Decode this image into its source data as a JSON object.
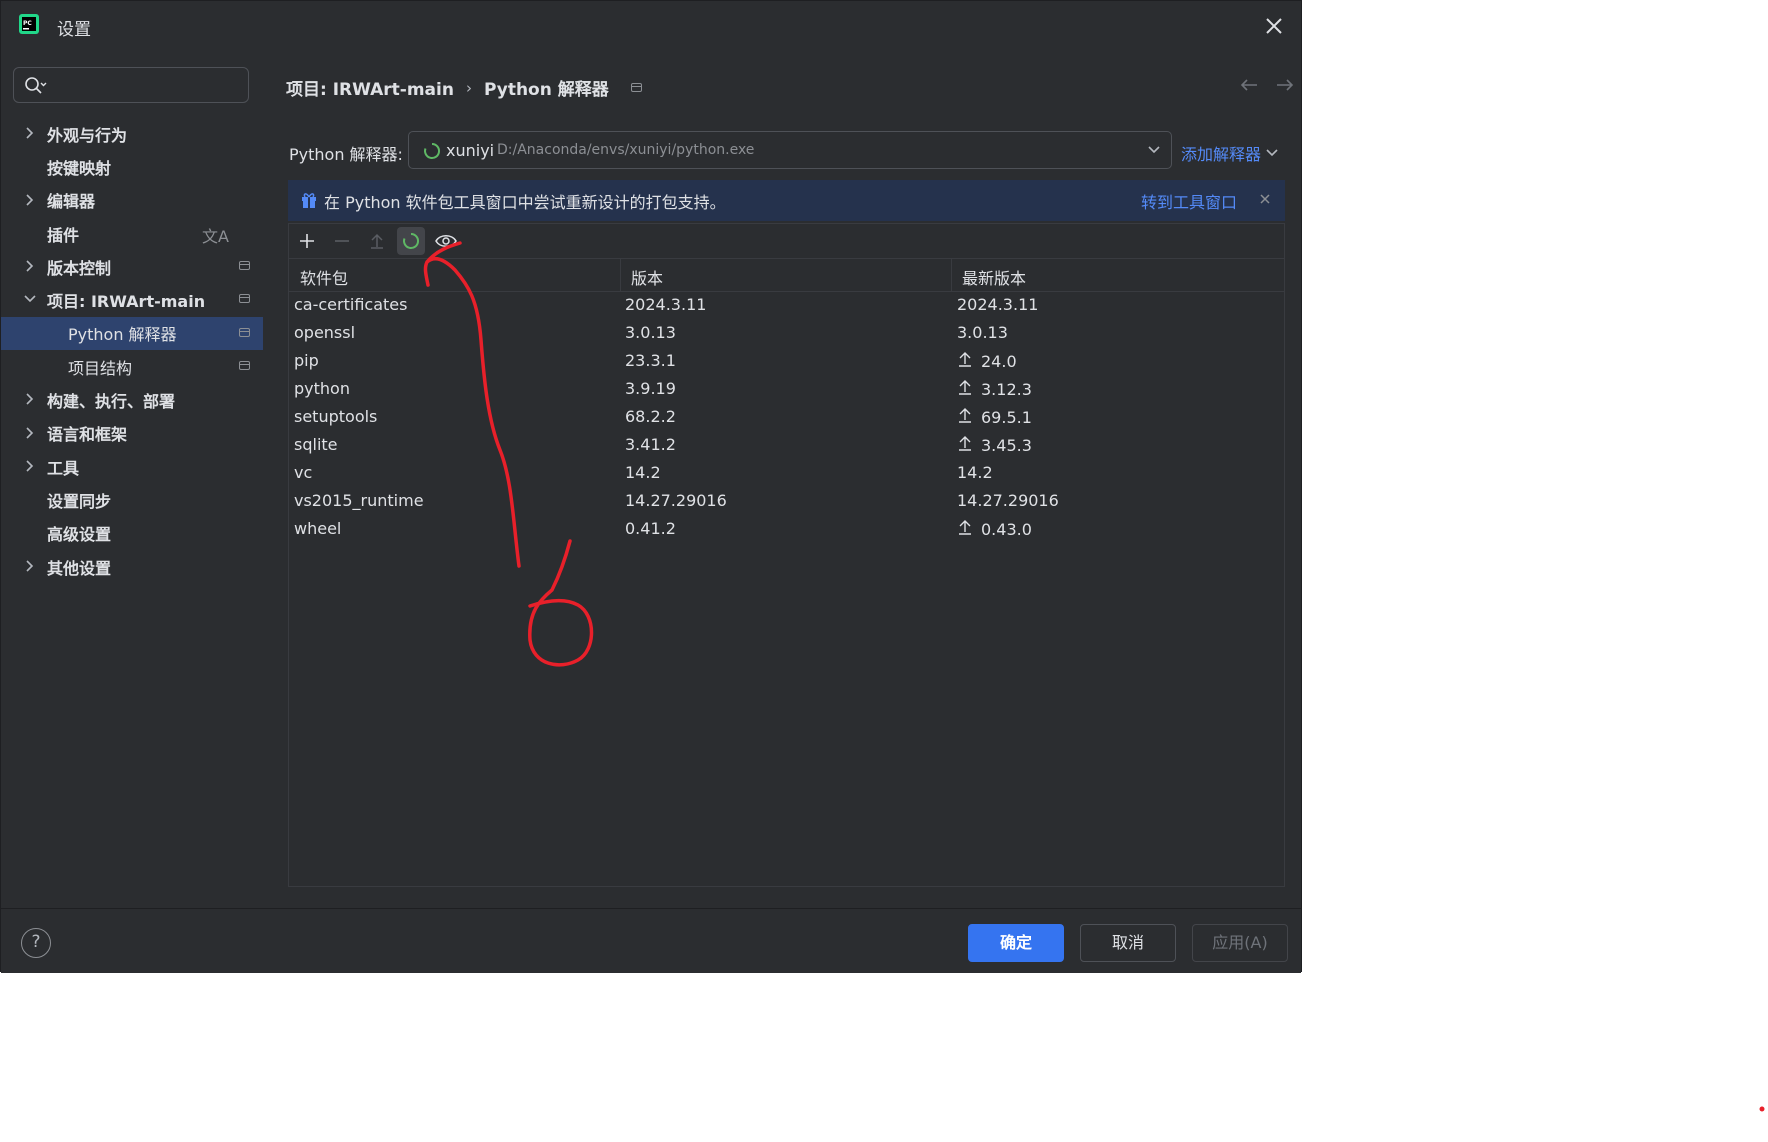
{
  "window": {
    "title": "设置"
  },
  "sidebar": {
    "items": [
      {
        "label": "外观与行为",
        "expandable": true
      },
      {
        "label": "按键映射"
      },
      {
        "label": "编辑器",
        "expandable": true
      },
      {
        "label": "插件",
        "icon": "translate-icon"
      },
      {
        "label": "版本控制",
        "expandable": true,
        "badge": true
      },
      {
        "label": "项目: IRWArt-main",
        "expandable": true,
        "expanded": true,
        "badge": true
      },
      {
        "label": "Python 解释器",
        "sub": true,
        "selected": true,
        "badge": true
      },
      {
        "label": "项目结构",
        "sub": true,
        "badge": true
      },
      {
        "label": "构建、执行、部署",
        "expandable": true
      },
      {
        "label": "语言和框架",
        "expandable": true
      },
      {
        "label": "工具",
        "expandable": true
      },
      {
        "label": "设置同步"
      },
      {
        "label": "高级设置"
      },
      {
        "label": "其他设置",
        "expandable": true
      }
    ]
  },
  "breadcrumb": {
    "project": "项目: IRWArt-main",
    "sep": "›",
    "page": "Python 解释器"
  },
  "interpreter": {
    "label": "Python 解释器:",
    "name": "xuniyi",
    "path": "D:/Anaconda/envs/xuniyi/python.exe",
    "add_label": "添加解释器"
  },
  "banner": {
    "text": "在 Python 软件包工具窗口中尝试重新设计的打包支持。",
    "link": "转到工具窗口"
  },
  "table": {
    "headers": [
      "软件包",
      "版本",
      "最新版本"
    ],
    "rows": [
      {
        "package": "ca-certificates",
        "version": "2024.3.11",
        "latest": "2024.3.11",
        "upgrade": false
      },
      {
        "package": "openssl",
        "version": "3.0.13",
        "latest": "3.0.13",
        "upgrade": false
      },
      {
        "package": "pip",
        "version": "23.3.1",
        "latest": "24.0",
        "upgrade": true
      },
      {
        "package": "python",
        "version": "3.9.19",
        "latest": "3.12.3",
        "upgrade": true
      },
      {
        "package": "setuptools",
        "version": "68.2.2",
        "latest": "69.5.1",
        "upgrade": true
      },
      {
        "package": "sqlite",
        "version": "3.41.2",
        "latest": "3.45.3",
        "upgrade": true
      },
      {
        "package": "vc",
        "version": "14.2",
        "latest": "14.2",
        "upgrade": false
      },
      {
        "package": "vs2015_runtime",
        "version": "14.27.29016",
        "latest": "14.27.29016",
        "upgrade": false
      },
      {
        "package": "wheel",
        "version": "0.41.2",
        "latest": "0.43.0",
        "upgrade": true
      }
    ]
  },
  "footer": {
    "help": "?",
    "ok": "确定",
    "cancel": "取消",
    "apply": "应用(A)"
  },
  "colors": {
    "accent": "#3574f0",
    "link": "#548af7",
    "selection": "#2e436e",
    "annotation": "#e8202a"
  }
}
